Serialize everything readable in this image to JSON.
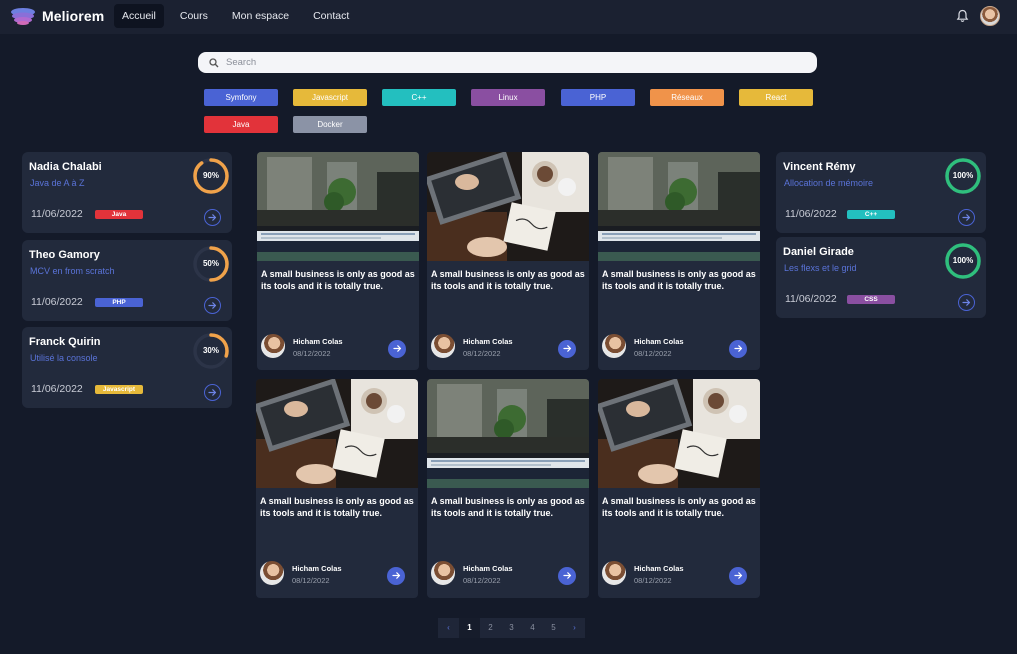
{
  "brand": "Meliorem",
  "nav": {
    "links": [
      "Accueil",
      "Cours",
      "Mon espace",
      "Contact"
    ]
  },
  "search": {
    "placeholder": "Search"
  },
  "tags": [
    {
      "label": "Symfony",
      "color": "#4a63d4"
    },
    {
      "label": "Javascript",
      "color": "#e6b93a"
    },
    {
      "label": "C++",
      "color": "#23bfbf"
    },
    {
      "label": "Linux",
      "color": "#8a4fa1"
    },
    {
      "label": "PHP",
      "color": "#4a63d4"
    },
    {
      "label": "Réseaux",
      "color": "#f0934a"
    },
    {
      "label": "React",
      "color": "#e6b93a"
    },
    {
      "label": "Java",
      "color": "#e2333a"
    },
    {
      "label": "Docker",
      "color": "#8b93a6"
    }
  ],
  "left_cards": [
    {
      "name": "Nadia Chalabi",
      "course": "Java de A à Z",
      "progress": "90%",
      "progress_value": 0.9,
      "date": "11/06/2022",
      "tag": "Java",
      "tag_color": "#e2333a",
      "ring_color": "#f0a24a"
    },
    {
      "name": "Theo Gamory",
      "course": "MCV en from scratch",
      "progress": "50%",
      "progress_value": 0.5,
      "date": "11/06/2022",
      "tag": "PHP",
      "tag_color": "#4a63d4",
      "ring_color": "#f0a24a"
    },
    {
      "name": "Franck Quirin",
      "course": "Utilisé la console",
      "progress": "30%",
      "progress_value": 0.3,
      "date": "11/06/2022",
      "tag": "Javascript",
      "tag_color": "#e6b93a",
      "ring_color": "#f0a24a"
    }
  ],
  "right_cards": [
    {
      "name": "Vincent Rémy",
      "course": "Allocation de mémoire",
      "progress": "100%",
      "progress_value": 1.0,
      "date": "11/06/2022",
      "tag": "C++",
      "tag_color": "#23bfbf",
      "ring_color": "#2fbf7d"
    },
    {
      "name": "Daniel Girade",
      "course": "Les flexs et le grid",
      "progress": "100%",
      "progress_value": 1.0,
      "date": "11/06/2022",
      "tag": "CSS",
      "tag_color": "#8a4fa1",
      "ring_color": "#2fbf7d"
    }
  ],
  "articles": [
    {
      "title": "A small business is only as good as its tools and it is totally true.",
      "author": "Hicham Colas",
      "date": "08/12/2022",
      "image": "office"
    },
    {
      "title": "A small business is only as good as its tools and it is totally true.",
      "author": "Hicham Colas",
      "date": "08/12/2022",
      "image": "desk"
    },
    {
      "title": "A small business is only as good as its tools and it is totally true.",
      "author": "Hicham Colas",
      "date": "08/12/2022",
      "image": "office"
    },
    {
      "title": "A small business is only as good as its tools and it is totally true.",
      "author": "Hicham Colas",
      "date": "08/12/2022",
      "image": "desk"
    },
    {
      "title": "A small business is only as good as its tools and it is totally true.",
      "author": "Hicham Colas",
      "date": "08/12/2022",
      "image": "office"
    },
    {
      "title": "A small business is only as good as its tools and it is totally true.",
      "author": "Hicham Colas",
      "date": "08/12/2022",
      "image": "desk"
    }
  ],
  "pagination": {
    "prev": "‹",
    "pages": [
      "1",
      "2",
      "3",
      "4",
      "5"
    ],
    "next": "›",
    "current": "1"
  }
}
